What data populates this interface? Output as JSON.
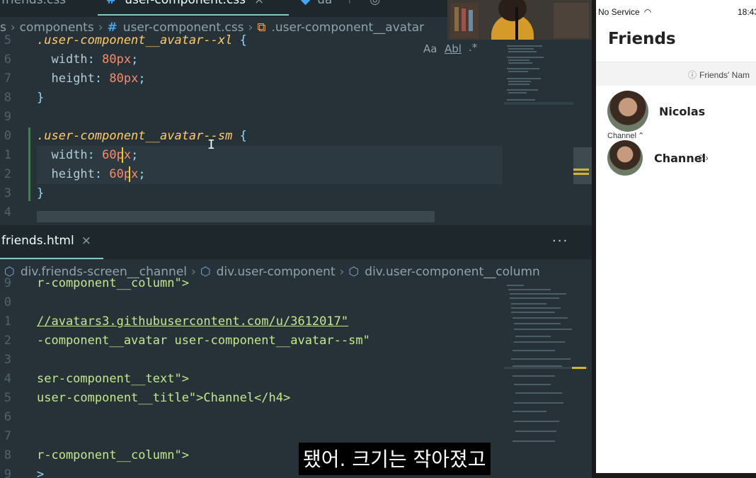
{
  "top_tabs": {
    "prev_file": "friends.css",
    "active_file": "user-component.css",
    "other_tab": "ua"
  },
  "css_breadcrumb": {
    "parts": [
      "s",
      "components",
      "user-component.css",
      ".user-component__avatar"
    ]
  },
  "css_editor": {
    "gutter": [
      "5",
      "6",
      "7",
      "8",
      "9",
      "0",
      "1",
      "2",
      "3",
      "4"
    ],
    "lines": [
      {
        "sel": ".user-component__avatar--xl",
        "brace": " {"
      },
      {
        "prop": "width",
        "num": "80",
        "unit": "px"
      },
      {
        "prop": "height",
        "num": "80",
        "unit": "px"
      },
      {
        "close": "}"
      },
      {
        "blank": ""
      },
      {
        "sel": ".user-component__avatar--sm",
        "brace": " {"
      },
      {
        "prop": "width",
        "num": "60",
        "unit": "px"
      },
      {
        "prop": "height",
        "num": "60",
        "unit": "px"
      },
      {
        "close": "}"
      }
    ]
  },
  "find_toolbar": {
    "match_case": "Aa",
    "whole_word": "Abl",
    "regex": ".*"
  },
  "html_pane": {
    "tab_label": "friends.html",
    "close_glyph": "×",
    "more_glyph": "···",
    "breadcrumb": [
      "div.friends-screen__channel",
      "div.user-component",
      "div.user-component__column"
    ],
    "gutter": [
      "9",
      "0",
      "1",
      "2",
      "3",
      "4",
      "5",
      "6",
      "7",
      "8",
      "9"
    ],
    "lines": [
      "r-component__column\">",
      "",
      "//avatars3.githubusercontent.com/u/3612017\"",
      "-component__avatar user-component__avatar--sm\"",
      "",
      "ser-component__text\">",
      "user-component__title\">Channel</h4>",
      "",
      "",
      "r-component__column\">",
      ">"
    ]
  },
  "phone": {
    "carrier": "No Service",
    "time": "18:43",
    "title": "Friends",
    "section_label": "Friends' Nam",
    "friends": [
      {
        "name": "Nicolas",
        "sub_label": "Channel"
      },
      {
        "name": "Channel",
        "count": "2"
      }
    ]
  },
  "subtitle": "됐어. 크기는 작아졌고",
  "colors": {
    "editor_bg": "#263238",
    "selector": "#ffcb6b",
    "number": "#f78c6c",
    "string": "#c3e88d",
    "tag": "#f07178",
    "cursor": "#ffcc00"
  },
  "icons": [
    "css-file-icon",
    "symbol-class-icon",
    "component-cube-icon",
    "chevron-right-icon",
    "info-icon",
    "wifi-icon",
    "chevron-up-icon"
  ]
}
